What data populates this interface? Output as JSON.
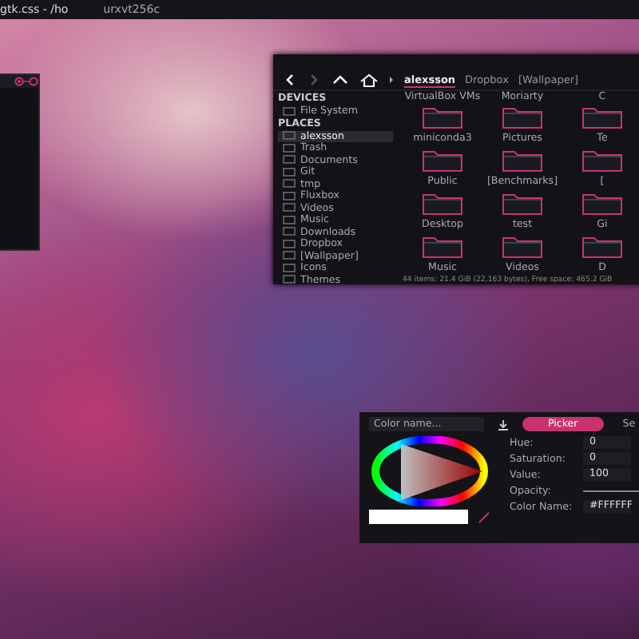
{
  "top_bar": {
    "tasks": [
      {
        "label": "gtk.css - /ho",
        "selected": true
      },
      {
        "label": "urxvt256c",
        "selected": false
      }
    ]
  },
  "file_manager": {
    "breadcrumb": [
      {
        "label": "alexsson",
        "selected": true
      },
      {
        "label": "Dropbox",
        "selected": false
      },
      {
        "label": "[Wallpaper]",
        "selected": false
      }
    ],
    "sidebar": [
      {
        "kind": "header",
        "label": "DEVICES"
      },
      {
        "kind": "item",
        "label": "File System",
        "selected": false
      },
      {
        "kind": "header",
        "label": "PLACES"
      },
      {
        "kind": "item",
        "label": "alexsson",
        "selected": true
      },
      {
        "kind": "item",
        "label": "Trash",
        "selected": false
      },
      {
        "kind": "item",
        "label": "Documents",
        "selected": false
      },
      {
        "kind": "item",
        "label": "Git",
        "selected": false
      },
      {
        "kind": "item",
        "label": "tmp",
        "selected": false
      },
      {
        "kind": "item",
        "label": "Fluxbox",
        "selected": false
      },
      {
        "kind": "item",
        "label": "Videos",
        "selected": false
      },
      {
        "kind": "item",
        "label": "Music",
        "selected": false
      },
      {
        "kind": "item",
        "label": "Downloads",
        "selected": false
      },
      {
        "kind": "item",
        "label": "Dropbox",
        "selected": false
      },
      {
        "kind": "item",
        "label": "[Wallpaper]",
        "selected": false
      },
      {
        "kind": "item",
        "label": "Icons",
        "selected": false
      },
      {
        "kind": "item",
        "label": "Themes",
        "selected": false
      }
    ],
    "top_labels": [
      "VirtualBox VMs",
      "Moriarty",
      "C"
    ],
    "folders": [
      {
        "label": "miniconda3"
      },
      {
        "label": "Pictures"
      },
      {
        "label": "Te"
      },
      {
        "label": "Public"
      },
      {
        "label": "[Benchmarks]"
      },
      {
        "label": "["
      },
      {
        "label": "Desktop"
      },
      {
        "label": "test"
      },
      {
        "label": "Gi"
      },
      {
        "label": "Music"
      },
      {
        "label": "Videos"
      },
      {
        "label": "D"
      }
    ],
    "status": "44 items: 21.4 GiB (22,163 bytes), Free space: 465.2 GiB"
  },
  "color_picker": {
    "name_placeholder": "Color name...",
    "tabs": [
      {
        "label": "Picker",
        "selected": true
      },
      {
        "label": "Se",
        "selected": false
      }
    ],
    "fields": [
      {
        "kind": "number",
        "label": "Hue:",
        "value": "0"
      },
      {
        "kind": "number",
        "label": "Saturation:",
        "value": "0"
      },
      {
        "kind": "number",
        "label": "Value:",
        "value": "100"
      },
      {
        "kind": "slider",
        "label": "Opacity:",
        "level": 1
      },
      {
        "kind": "text",
        "label": "Color Name:",
        "value": "#FFFFFF"
      }
    ]
  }
}
